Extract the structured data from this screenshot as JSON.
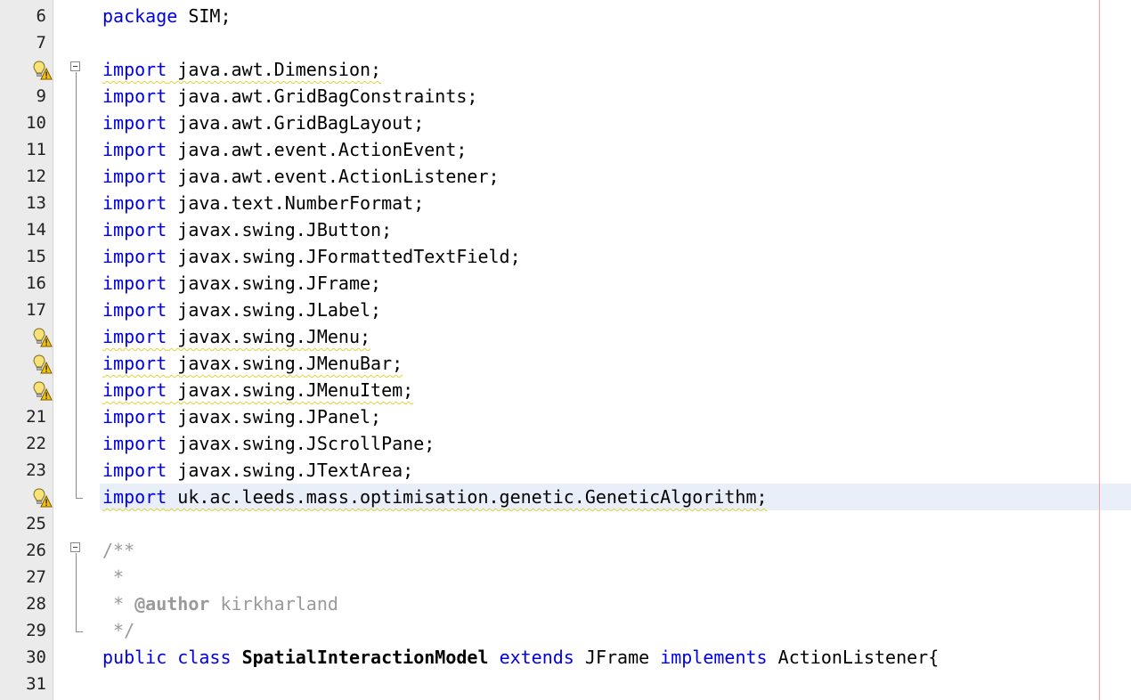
{
  "editor": {
    "lines": [
      {
        "num": "6",
        "parts": [
          {
            "t": "package",
            "c": "kw"
          },
          {
            "t": " SIM;",
            "c": ""
          }
        ]
      },
      {
        "num": "7",
        "parts": []
      },
      {
        "num": "",
        "bulb": true,
        "parts": [
          {
            "t": "import",
            "c": "kw warn"
          },
          {
            "t": " java.awt.Dimension;",
            "c": "warn"
          }
        ]
      },
      {
        "num": "9",
        "parts": [
          {
            "t": "import",
            "c": "kw"
          },
          {
            "t": " java.awt.GridBagConstraints;",
            "c": ""
          }
        ]
      },
      {
        "num": "10",
        "parts": [
          {
            "t": "import",
            "c": "kw"
          },
          {
            "t": " java.awt.GridBagLayout;",
            "c": ""
          }
        ]
      },
      {
        "num": "11",
        "parts": [
          {
            "t": "import",
            "c": "kw"
          },
          {
            "t": " java.awt.event.ActionEvent;",
            "c": ""
          }
        ]
      },
      {
        "num": "12",
        "parts": [
          {
            "t": "import",
            "c": "kw"
          },
          {
            "t": " java.awt.event.ActionListener;",
            "c": ""
          }
        ]
      },
      {
        "num": "13",
        "parts": [
          {
            "t": "import",
            "c": "kw"
          },
          {
            "t": " java.text.NumberFormat;",
            "c": ""
          }
        ]
      },
      {
        "num": "14",
        "parts": [
          {
            "t": "import",
            "c": "kw"
          },
          {
            "t": " javax.swing.JButton;",
            "c": ""
          }
        ]
      },
      {
        "num": "15",
        "parts": [
          {
            "t": "import",
            "c": "kw"
          },
          {
            "t": " javax.swing.JFormattedTextField;",
            "c": ""
          }
        ]
      },
      {
        "num": "16",
        "parts": [
          {
            "t": "import",
            "c": "kw"
          },
          {
            "t": " javax.swing.JFrame;",
            "c": ""
          }
        ]
      },
      {
        "num": "17",
        "parts": [
          {
            "t": "import",
            "c": "kw"
          },
          {
            "t": " javax.swing.JLabel;",
            "c": ""
          }
        ]
      },
      {
        "num": "",
        "bulb": true,
        "parts": [
          {
            "t": "import",
            "c": "kw warn"
          },
          {
            "t": " javax.swing.JMenu;",
            "c": "warn"
          }
        ]
      },
      {
        "num": "",
        "bulb": true,
        "parts": [
          {
            "t": "import",
            "c": "kw warn"
          },
          {
            "t": " javax.swing.JMenuBar;",
            "c": "warn"
          }
        ]
      },
      {
        "num": "",
        "bulb": true,
        "parts": [
          {
            "t": "import",
            "c": "kw warn"
          },
          {
            "t": " javax.swing.JMenuItem;",
            "c": "warn"
          }
        ]
      },
      {
        "num": "21",
        "parts": [
          {
            "t": "import",
            "c": "kw"
          },
          {
            "t": " javax.swing.JPanel;",
            "c": ""
          }
        ]
      },
      {
        "num": "22",
        "parts": [
          {
            "t": "import",
            "c": "kw"
          },
          {
            "t": " javax.swing.JScrollPane;",
            "c": ""
          }
        ]
      },
      {
        "num": "23",
        "parts": [
          {
            "t": "import",
            "c": "kw"
          },
          {
            "t": " javax.swing.JTextArea;",
            "c": ""
          }
        ]
      },
      {
        "num": "",
        "bulb": true,
        "current": true,
        "parts": [
          {
            "t": "import",
            "c": "kw warn"
          },
          {
            "t": " uk.ac.leeds.mass.optimisation.genetic.GeneticAlgorithm;",
            "c": "warn"
          }
        ]
      },
      {
        "num": "25",
        "parts": []
      },
      {
        "num": "26",
        "parts": [
          {
            "t": "/**",
            "c": "comment"
          }
        ]
      },
      {
        "num": "27",
        "parts": [
          {
            "t": " *",
            "c": "comment"
          }
        ]
      },
      {
        "num": "28",
        "parts": [
          {
            "t": " * ",
            "c": "comment"
          },
          {
            "t": "@author",
            "c": "tag"
          },
          {
            "t": " kirkharland",
            "c": "comment"
          }
        ]
      },
      {
        "num": "29",
        "parts": [
          {
            "t": " */",
            "c": "comment"
          }
        ]
      },
      {
        "num": "30",
        "parts": [
          {
            "t": "public",
            "c": "kw"
          },
          {
            "t": " ",
            "c": ""
          },
          {
            "t": "class",
            "c": "kw"
          },
          {
            "t": " ",
            "c": ""
          },
          {
            "t": "SpatialInteractionModel",
            "c": "bold"
          },
          {
            "t": " ",
            "c": ""
          },
          {
            "t": "extends",
            "c": "kw"
          },
          {
            "t": " JFrame ",
            "c": ""
          },
          {
            "t": "implements",
            "c": "kw"
          },
          {
            "t": " ActionListener{",
            "c": ""
          }
        ]
      },
      {
        "num": "31",
        "parts": []
      }
    ]
  }
}
